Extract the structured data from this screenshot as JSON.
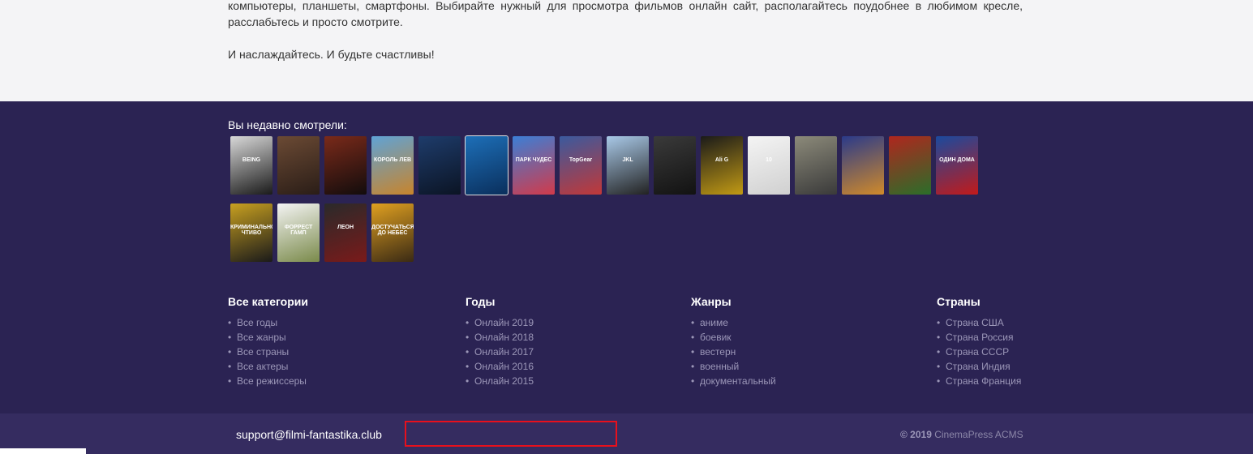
{
  "content": {
    "paragraph1": "компьютеры, планшеты, смартфоны. Выбирайте нужный для просмотра фильмов онлайн сайт, располагайтесь поудобнее в любимом кресле, расслабьтесь и просто смотрите.",
    "paragraph2": "И наслаждайтесь. И будьте счастливы!"
  },
  "recent": {
    "title": "Вы недавно смотрели:",
    "posters": [
      {
        "colors": [
          "#d9d9d9",
          "#1a1a1a"
        ],
        "text": "BEING"
      },
      {
        "colors": [
          "#6b4a34",
          "#2a1d17"
        ],
        "text": ""
      },
      {
        "colors": [
          "#7a2a1a",
          "#120c0c"
        ],
        "text": ""
      },
      {
        "colors": [
          "#5fa3d6",
          "#c8842b"
        ],
        "text": "КОРОЛЬ ЛЕВ"
      },
      {
        "colors": [
          "#1e3c6b",
          "#0b1424"
        ],
        "text": ""
      },
      {
        "colors": [
          "#1d6fb8",
          "#0a2f5c"
        ],
        "text": ""
      },
      {
        "colors": [
          "#3b7fd6",
          "#d23a4a"
        ],
        "text": "ПАРК ЧУДЕС"
      },
      {
        "colors": [
          "#3a5a9e",
          "#c23838"
        ],
        "text": "TopGear"
      },
      {
        "colors": [
          "#a9c9e8",
          "#222222"
        ],
        "text": "JKL"
      },
      {
        "colors": [
          "#3a3a3a",
          "#121212"
        ],
        "text": ""
      },
      {
        "colors": [
          "#1a1a1a",
          "#c29a14"
        ],
        "text": "Ali G"
      },
      {
        "colors": [
          "#f4f4f4",
          "#d0d0d0"
        ],
        "text": "10"
      },
      {
        "colors": [
          "#8c8a7a",
          "#3a3a3a"
        ],
        "text": ""
      },
      {
        "colors": [
          "#2a3a8a",
          "#d08a2a"
        ],
        "text": ""
      },
      {
        "colors": [
          "#b0261e",
          "#2a6e2a"
        ],
        "text": ""
      },
      {
        "colors": [
          "#1a4a9e",
          "#c21a1a"
        ],
        "text": "ОДИН ДОМА"
      },
      {
        "colors": [
          "#c8a020",
          "#1a1a1a"
        ],
        "text": "КРИМИНАЛЬНОЕ ЧТИВО"
      },
      {
        "colors": [
          "#f4f4f4",
          "#7a8a4a"
        ],
        "text": "ФОРРЕСТ ГАМП"
      },
      {
        "colors": [
          "#2a2a2a",
          "#7a1a1a"
        ],
        "text": "ЛЕОН"
      },
      {
        "colors": [
          "#e0a020",
          "#3a2a14"
        ],
        "text": "ДОСТУЧАТЬСЯ ДО НЕБЕС"
      }
    ]
  },
  "footer": {
    "columns": [
      {
        "title": "Все категории",
        "items": [
          "Все годы",
          "Все жанры",
          "Все страны",
          "Все актеры",
          "Все режиссеры"
        ]
      },
      {
        "title": "Годы",
        "items": [
          "Онлайн 2019",
          "Онлайн 2018",
          "Онлайн 2017",
          "Онлайн 2016",
          "Онлайн 2015"
        ]
      },
      {
        "title": "Жанры",
        "items": [
          "аниме",
          "боевик",
          "вестерн",
          "военный",
          "документальный"
        ]
      },
      {
        "title": "Страны",
        "items": [
          "Страна США",
          "Страна Россия",
          "Страна СССР",
          "Страна Индия",
          "Страна Франция"
        ]
      }
    ],
    "support_email": "support@filmi-fantastika.club",
    "copyright_year": "© 2019",
    "copyright_brand": "CinemaPress ACMS"
  }
}
